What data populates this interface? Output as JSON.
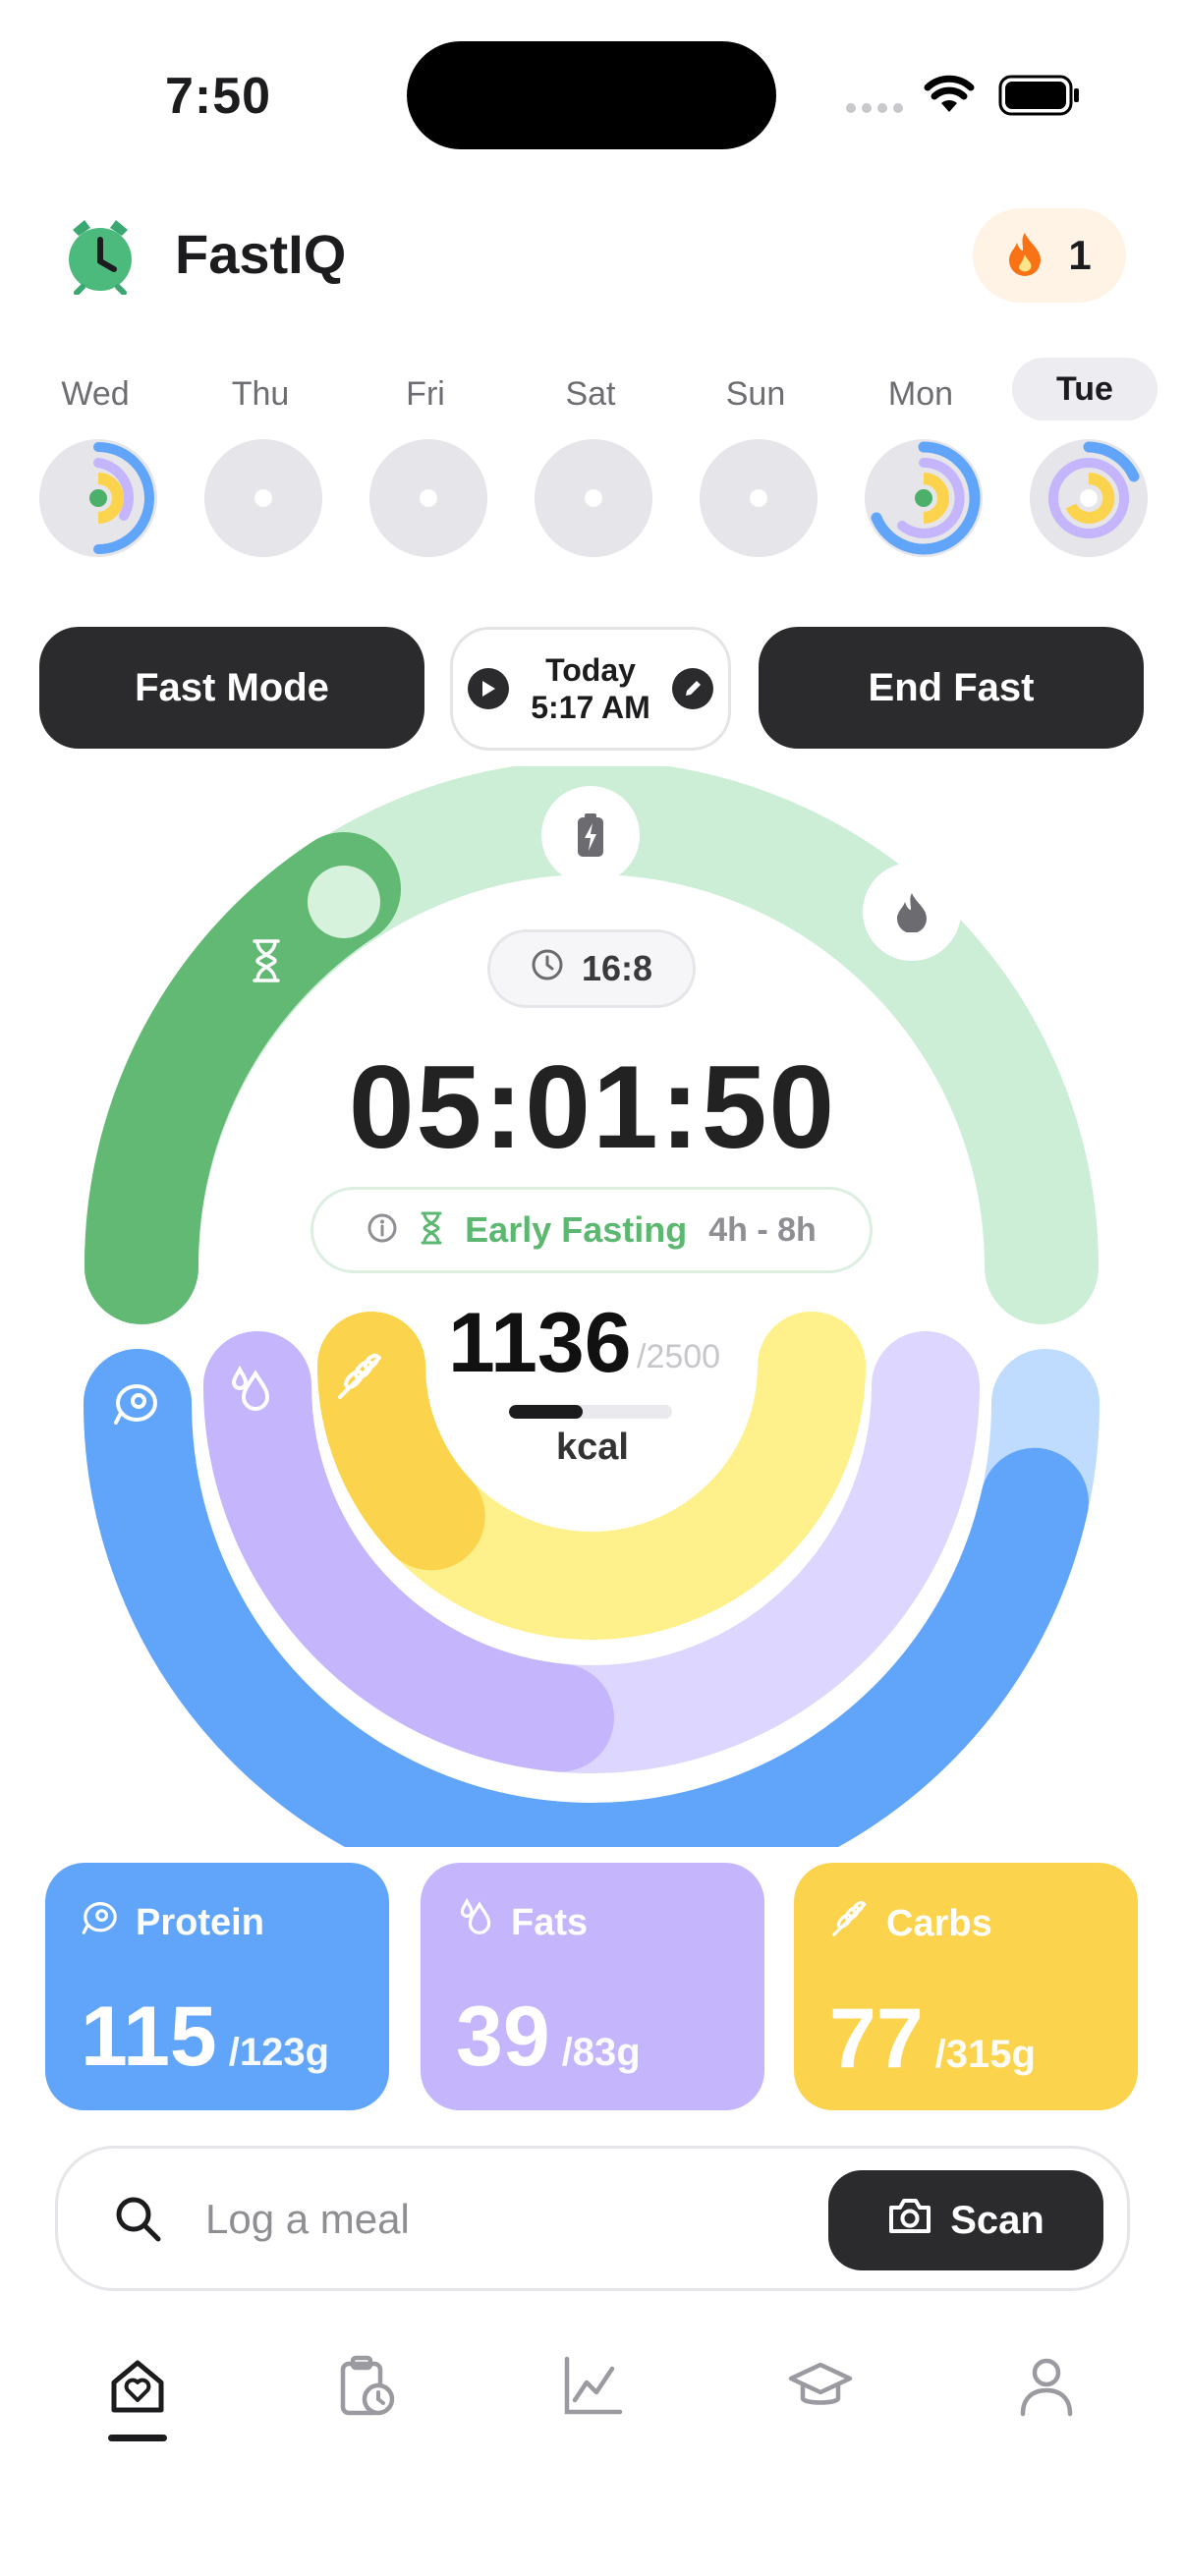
{
  "status_bar": {
    "time": "7:50"
  },
  "header": {
    "app_name": "FastIQ",
    "streak_count": "1"
  },
  "week": {
    "days": [
      "Wed",
      "Thu",
      "Fri",
      "Sat",
      "Sun",
      "Mon",
      "Tue"
    ],
    "selected": "Tue"
  },
  "controls": {
    "fast_mode_label": "Fast Mode",
    "start_day": "Today",
    "start_time": "5:17 AM",
    "end_fast_label": "End Fast"
  },
  "fasting": {
    "ratio": "16:8",
    "timer": "05:01:50",
    "phase_name": "Early Fasting",
    "phase_range": "4h - 8h"
  },
  "calories": {
    "consumed": "1136",
    "goal": "/2500",
    "unit": "kcal",
    "progress_fraction": 0.45
  },
  "macros": [
    {
      "name": "Protein",
      "value": "115",
      "target": "/123g",
      "color": "#60a5fa",
      "fraction": 0.93
    },
    {
      "name": "Fats",
      "value": "39",
      "target": "/83g",
      "color": "#c4b5fd",
      "fraction": 0.47
    },
    {
      "name": "Carbs",
      "value": "77",
      "target": "/315g",
      "color": "#fcd34d",
      "fraction": 0.24
    }
  ],
  "log": {
    "placeholder": "Log a meal",
    "scan_label": "Scan"
  },
  "tabs": [
    "home",
    "fasting-log",
    "progress",
    "learn",
    "profile"
  ],
  "colors": {
    "fasting_green": "#62b974",
    "fasting_track": "#cdeed6",
    "protein": "#60a5fa",
    "fats": "#c4b5fd",
    "carbs": "#fcd34d",
    "dark": "#2b2b2d",
    "streak_orange": "#f97316"
  }
}
